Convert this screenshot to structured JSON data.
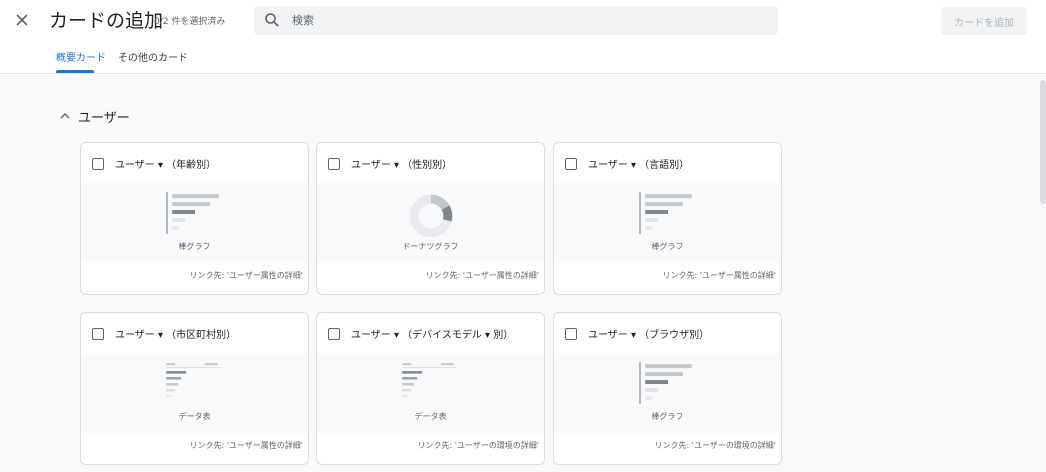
{
  "header": {
    "title": "カードの追加",
    "selection_count": "0/2 件を選択済み",
    "search_placeholder": "検索",
    "add_button_label": "カードを追加"
  },
  "tabs": [
    {
      "label": "概要カード",
      "active": true
    },
    {
      "label": "その他のカード",
      "active": false
    }
  ],
  "section": {
    "title": "ユーザー"
  },
  "cards": [
    {
      "title": "ユーザー ▾ （年齢別）",
      "chart_type": "棒グラフ",
      "link": "リンク先: 'ユーザー属性の詳細'",
      "thumbnail": "bar-chart-icon"
    },
    {
      "title": "ユーザー ▾ （性別別）",
      "chart_type": "ドーナツグラフ",
      "link": "リンク先: 'ユーザー属性の詳細'",
      "thumbnail": "donut-chart-icon"
    },
    {
      "title": "ユーザー ▾ （言語別）",
      "chart_type": "棒グラフ",
      "link": "リンク先: 'ユーザー属性の詳細'",
      "thumbnail": "bar-chart-icon"
    },
    {
      "title": "ユーザー ▾ （市区町村別）",
      "chart_type": "データ表",
      "link": "リンク先: 'ユーザー属性の詳細'",
      "thumbnail": "data-table-icon"
    },
    {
      "title": "ユーザー ▾ （デバイスモデル ▾ 別）",
      "chart_type": "データ表",
      "link": "リンク先: 'ユーザーの環境の詳細'",
      "thumbnail": "data-table-icon"
    },
    {
      "title": "ユーザー ▾ （ブラウザ別）",
      "chart_type": "棒グラフ",
      "link": "リンク先: 'ユーザーの環境の詳細'",
      "thumbnail": "bar-chart-icon"
    }
  ],
  "colors": {
    "accent": "#1a73e8",
    "background": "#f8f9fa",
    "card_border": "#dadce0"
  }
}
